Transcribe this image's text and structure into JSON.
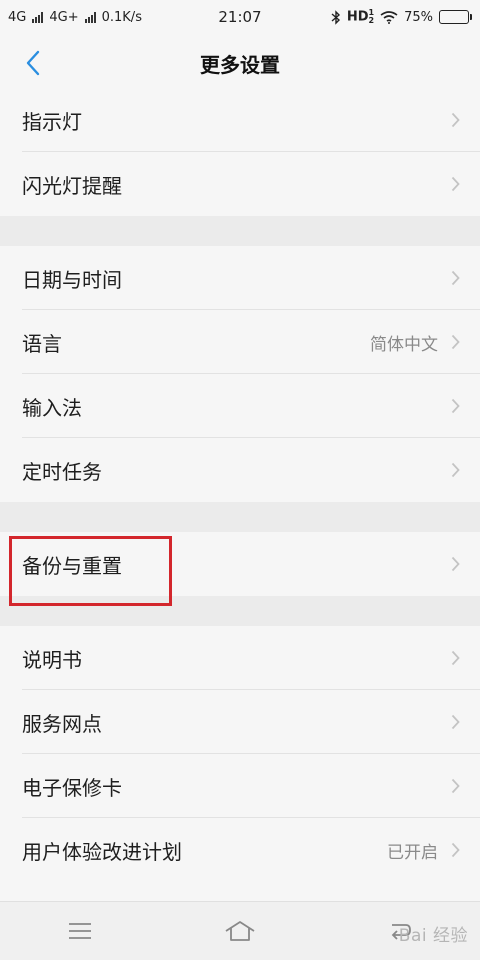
{
  "status_bar": {
    "network1": "4G",
    "network2": "4G+",
    "speed": "0.1K/s",
    "time": "21:07",
    "hd_text": "HD",
    "hd_super": "1",
    "hd_sub": "2",
    "battery_text": "75%",
    "battery_level": 0.75
  },
  "nav": {
    "title": "更多设置",
    "back_icon": "chevron-left-icon"
  },
  "groups": [
    {
      "items": [
        {
          "label": "指示灯"
        },
        {
          "label": "闪光灯提醒"
        }
      ]
    },
    {
      "items": [
        {
          "label": "日期与时间"
        },
        {
          "label": "语言",
          "value": "简体中文"
        },
        {
          "label": "输入法"
        },
        {
          "label": "定时任务"
        }
      ]
    },
    {
      "items": [
        {
          "label": "备份与重置"
        }
      ]
    },
    {
      "items": [
        {
          "label": "说明书"
        },
        {
          "label": "服务网点"
        },
        {
          "label": "电子保修卡"
        },
        {
          "label": "用户体验改进计划",
          "value": "已开启"
        }
      ]
    }
  ],
  "highlight": {
    "target": "备份与重置",
    "color": "#d3262c"
  },
  "bottom_bar": {
    "icons": [
      "menu-icon",
      "home-icon",
      "back-nav-icon"
    ]
  },
  "watermark": "Bai 经验",
  "colors": {
    "accent": "#2a8ee0",
    "background": "#f6f6f6",
    "separator": "#ebebeb",
    "highlight": "#d3262c"
  }
}
